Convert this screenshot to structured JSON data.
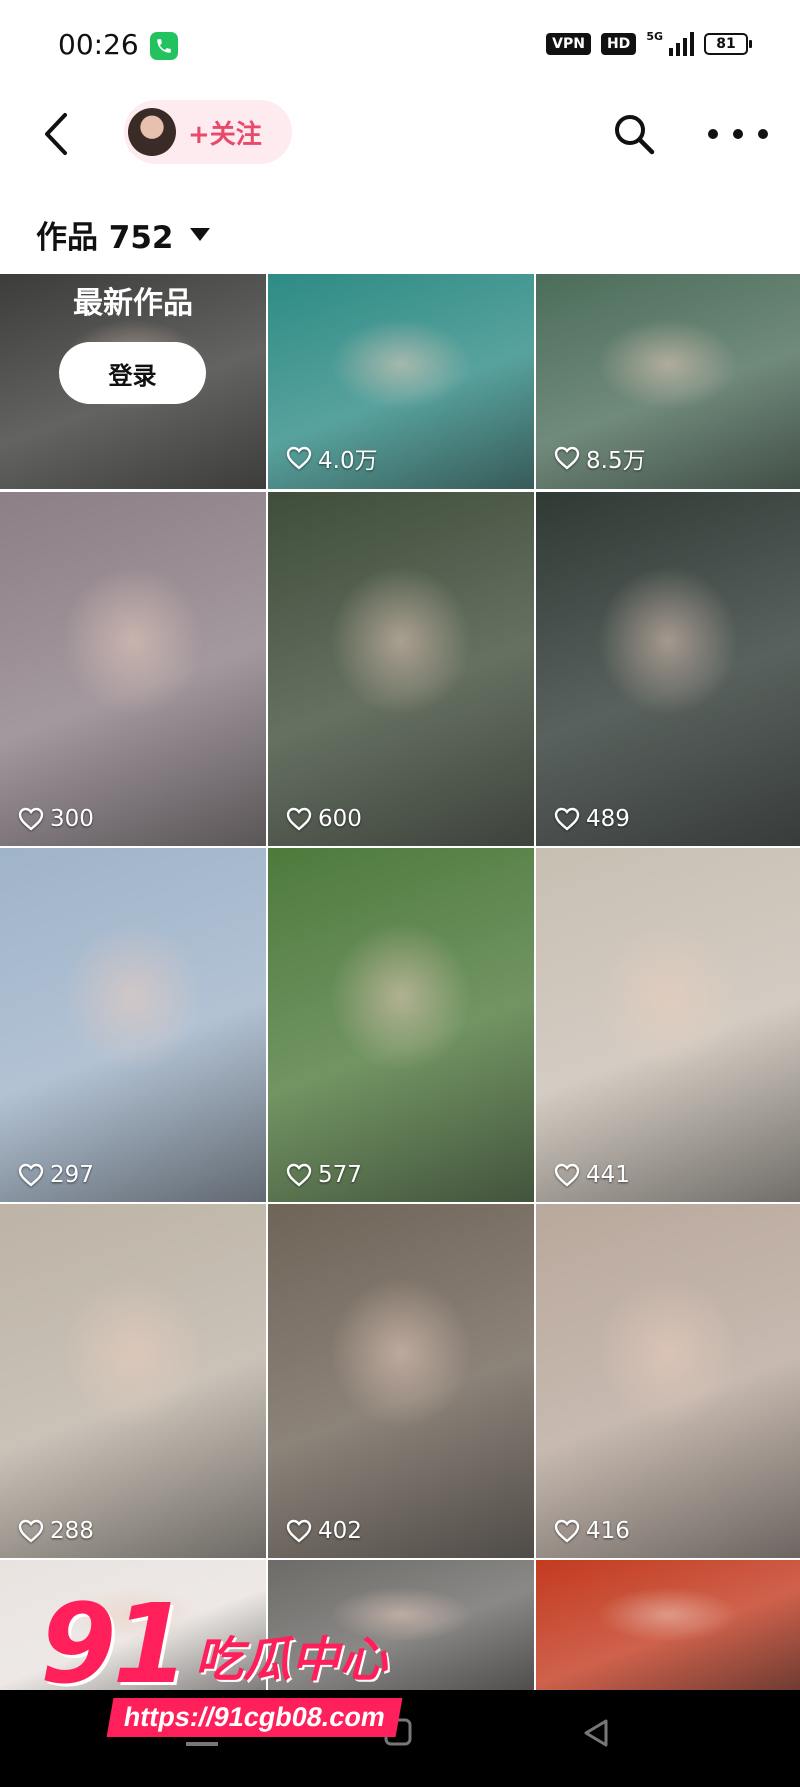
{
  "status_bar": {
    "time": "00:26",
    "vpn": "VPN",
    "hd": "HD",
    "network": "5G",
    "battery": "81"
  },
  "header": {
    "follow_label": "+关注"
  },
  "works": {
    "label": "作品 752"
  },
  "grid": {
    "latest_title": "最新作品",
    "login_label": "登录",
    "tiles": [
      {
        "likes": "",
        "bg": "#3c3c3a"
      },
      {
        "likes": "4.0万",
        "bg": "#2e8b85"
      },
      {
        "likes": "8.5万",
        "bg": "#4c6d5a"
      },
      {
        "likes": "300",
        "bg": "#8c7f86"
      },
      {
        "likes": "600",
        "bg": "#3f4d3a"
      },
      {
        "likes": "489",
        "bg": "#2f3a35"
      },
      {
        "likes": "297",
        "bg": "#9fb3c9"
      },
      {
        "likes": "577",
        "bg": "#4e7a3c"
      },
      {
        "likes": "441",
        "bg": "#c8bfb3"
      },
      {
        "likes": "288",
        "bg": "#bdb3a6"
      },
      {
        "likes": "402",
        "bg": "#6f6458"
      },
      {
        "likes": "416",
        "bg": "#b9a89c"
      },
      {
        "likes": "",
        "bg": "#e9e3e0"
      },
      {
        "likes": "",
        "bg": "#6d6b68"
      },
      {
        "likes": "",
        "bg": "#c33a1f"
      }
    ]
  },
  "watermark": {
    "number": "91",
    "text": "吃瓜中心",
    "url": "https://91cgb08.com"
  }
}
